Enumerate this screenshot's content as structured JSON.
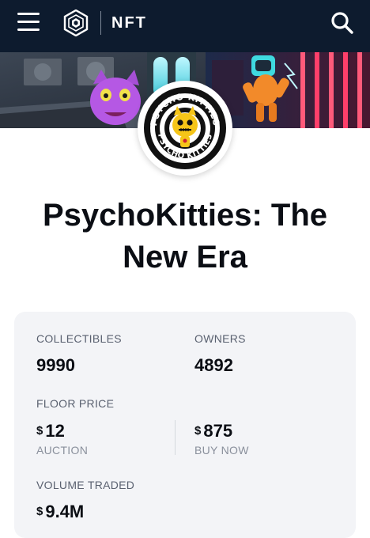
{
  "nav": {
    "title": "NFT",
    "menu_icon": "hamburger-menu-icon",
    "logo_icon": "crypto-com-logo",
    "search_icon": "search-icon"
  },
  "collection": {
    "title": "PsychoKitties: The New Era",
    "avatar_text_top": "PSYCHO KITTIES",
    "avatar_text_bottom": "PSYCHO KITTIES"
  },
  "stats": {
    "collectibles_label": "COLLECTIBLES",
    "collectibles_value": "9990",
    "owners_label": "OWNERS",
    "owners_value": "4892",
    "floor_price_label": "FLOOR PRICE",
    "currency_symbol": "$",
    "auction_value": "12",
    "auction_label": "AUCTION",
    "buy_now_value": "875",
    "buy_now_label": "BUY NOW",
    "volume_label": "VOLUME TRADED",
    "volume_value": "9.4M"
  },
  "colors": {
    "nav_bg": "#0d1b2e",
    "card_bg": "#f3f4f7",
    "text_primary": "#0b0e14",
    "text_secondary": "#5a6170"
  }
}
